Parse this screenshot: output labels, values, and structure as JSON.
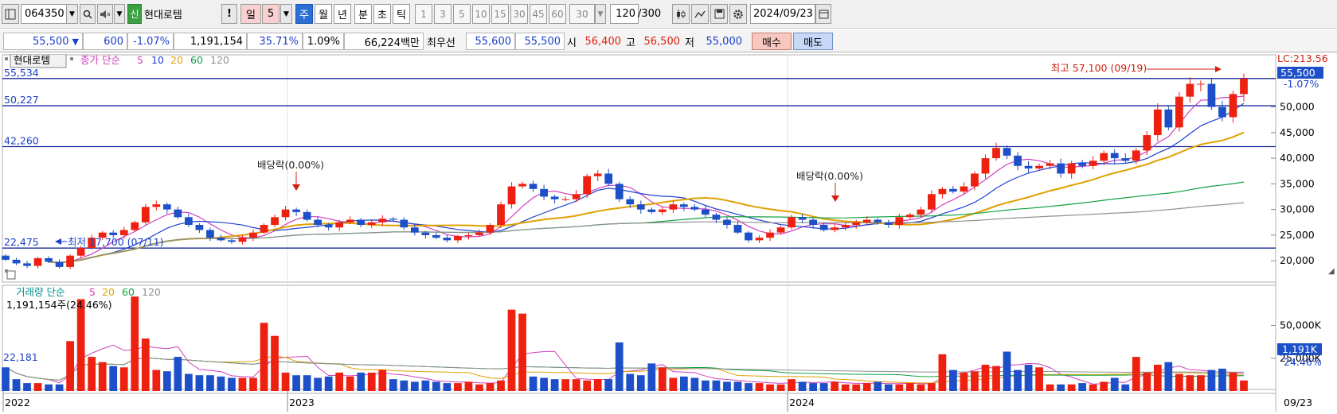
{
  "toolbar": {
    "code": "064350",
    "badge": "신",
    "name": "현대로템",
    "alert": "!",
    "period_day": "일",
    "period_num": "5",
    "tabs": [
      "주",
      "월",
      "년",
      "분",
      "초",
      "틱"
    ],
    "active_tab": "주",
    "intervals": [
      "1",
      "3",
      "5",
      "10",
      "15",
      "30",
      "45",
      "60"
    ],
    "interval_select": "30",
    "count": "120",
    "count_max": "/300",
    "date": "2024/09/23"
  },
  "info": {
    "price": "55,500",
    "change": "600",
    "change_pct": "-1.07%",
    "volume": "1,191,154",
    "vol_ratio": "35.71%",
    "turnover": "1.09%",
    "amount": "66,224백만",
    "best_label": "최우선",
    "best_ask": "55,600",
    "best_bid": "55,500",
    "open_label": "시",
    "open": "56,400",
    "high_label": "고",
    "high": "56,500",
    "low_label": "저",
    "low": "55,000",
    "buy": "매수",
    "sell": "매도"
  },
  "chart_data": [
    {
      "type": "candlestick",
      "legend": {
        "name": "현대로템",
        "series": "종가 단순",
        "periods": [
          "5",
          "10",
          "20",
          "60",
          "120"
        ],
        "colors": [
          "#d040c0",
          "#2040d0",
          "#e0a000",
          "#10a040",
          "#909090"
        ]
      },
      "x_labels": [
        "2022",
        "2023",
        "2024"
      ],
      "x_axis_bottom": "09/23",
      "y_ticks": [
        20000,
        25000,
        30000,
        35000,
        40000,
        45000,
        50000
      ],
      "y_tick_labels": [
        "20,000",
        "25,000",
        "30,000",
        "35,000",
        "40,000",
        "45,000",
        "50,000"
      ],
      "ylim": [
        16000,
        60000
      ],
      "horizontal_lines": [
        {
          "value": 55534,
          "label": "55,534"
        },
        {
          "value": 50227,
          "label": "50,227"
        },
        {
          "value": 42260,
          "label": "42,260"
        },
        {
          "value": 22475,
          "label": "22,475"
        }
      ],
      "annotations": {
        "high": "최고 57,100 (09/19)",
        "low": "최저 17,700 (07/11)",
        "dividend1": "배당락(0.00%)",
        "dividend2": "배당락(0.00%)"
      },
      "right_labels": {
        "lc": "LC:213.56",
        "price": "55,500",
        "pct": "-1.07%"
      },
      "colors": {
        "up": "#ee2010",
        "down": "#1c4fc8",
        "hline": "#1a2a9a"
      },
      "close": [
        20200,
        19500,
        19000,
        20500,
        19800,
        18800,
        21000,
        22500,
        24500,
        25500,
        25000,
        26000,
        27500,
        30500,
        31000,
        30000,
        28500,
        27000,
        26000,
        24500,
        24000,
        23700,
        24500,
        25500,
        27000,
        28500,
        30000,
        29500,
        28000,
        27000,
        26500,
        27500,
        28000,
        27000,
        27500,
        28200,
        28000,
        26500,
        25500,
        25000,
        24500,
        24000,
        24800,
        25000,
        25500,
        27000,
        31000,
        34500,
        35000,
        34000,
        32500,
        32000,
        32000,
        33000,
        36500,
        37000,
        35000,
        32000,
        31000,
        30000,
        29500,
        30000,
        31000,
        30500,
        30000,
        29000,
        28000,
        27000,
        25500,
        24000,
        24500,
        25500,
        26500,
        28500,
        28000,
        27000,
        26000,
        26500,
        27000,
        27500,
        28000,
        27500,
        27000,
        28500,
        29000,
        30000,
        33000,
        34000,
        33500,
        34500,
        37000,
        40000,
        42000,
        40500,
        38500,
        38000,
        38500,
        39000,
        37000,
        39000,
        38500,
        39500,
        41000,
        40000,
        39500,
        41500,
        44500,
        49500,
        46000,
        52000,
        54500,
        54500,
        50000,
        48000,
        52500,
        55500
      ],
      "volume_series": {
        "legend": "거래량 단순",
        "periods": [
          "5",
          "20",
          "60",
          "120"
        ],
        "current": "1,191,154주(24.46%)",
        "y_ticks": [
          25000000,
          50000000
        ],
        "y_tick_labels": [
          "25,000K",
          "50,000K"
        ],
        "ylim": [
          0,
          80000000
        ],
        "right_labels": {
          "vol": "1,191K",
          "pct": "24.46%"
        },
        "left_label": "22,181",
        "values": [
          18,
          9,
          6,
          6,
          5,
          5,
          38,
          70,
          26,
          22,
          19,
          18,
          72,
          40,
          16,
          15,
          26,
          13,
          12,
          12,
          11,
          10,
          10,
          10,
          52,
          42,
          14,
          12,
          12,
          10,
          11,
          14,
          11,
          14,
          14,
          16,
          9,
          8,
          7,
          8,
          7,
          6,
          6,
          7,
          5,
          6,
          8,
          62,
          59,
          11,
          10,
          9,
          9,
          9,
          8,
          9,
          9,
          37,
          13,
          12,
          21,
          18,
          10,
          11,
          10,
          8,
          8,
          7,
          7,
          6,
          6,
          5,
          5,
          9,
          7,
          6,
          6,
          7,
          5,
          5,
          6,
          7,
          5,
          5,
          6,
          5,
          6,
          28,
          16,
          14,
          15,
          20,
          19,
          30,
          16,
          20,
          18,
          5,
          5,
          5,
          6,
          5,
          7,
          10,
          5,
          26,
          14,
          20,
          22,
          13,
          12,
          12,
          16,
          17,
          14,
          8
        ]
      }
    }
  ]
}
